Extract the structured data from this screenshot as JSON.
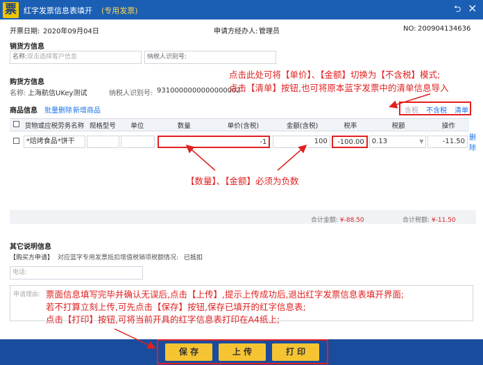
{
  "window": {
    "title": "红字发票信息表填开",
    "title_tag": "(专用发票)",
    "logo_char": "票",
    "back_icon": "undo-icon",
    "close_icon": "close-icon"
  },
  "header": {
    "date_label": "开票日期:",
    "date_value": "2020年09月04日",
    "handler_label": "申请方经办人:",
    "handler_value": "管理员",
    "no_label": "NO:",
    "no_value": "200904134636"
  },
  "seller": {
    "section": "销货方信息",
    "name_label": "名称:",
    "name_placeholder": "双击选择客户信息",
    "taxid_label": "纳税人识别号:"
  },
  "buyer": {
    "section": "购货方信息",
    "name_label": "名称:",
    "name_value": "上海航信UKey测试",
    "taxid_label": "纳税人识别号:",
    "taxid_value": "9310000000000000002"
  },
  "goods": {
    "section": "商品信息",
    "batch_delete": "批量删除",
    "add_goods": "新增商品",
    "mode_tax_included": "含税",
    "mode_tax_excluded": "不含税",
    "list_label": "清单",
    "columns": [
      "货物或应税劳务名称",
      "规格型号",
      "单位",
      "数量",
      "单价(含税)",
      "金额(含税)",
      "税率",
      "税额",
      "操作"
    ],
    "row": {
      "name": "*焙烤食品*饼干",
      "spec": "",
      "unit": "",
      "qty": "-1",
      "price": "100",
      "amount": "-100.00",
      "rate": "0.13",
      "tax": "-11.50",
      "action": "删除"
    }
  },
  "totals": {
    "amount_label": "合计金额:",
    "amount_value": "¥-88.50",
    "tax_label": "合计税额:",
    "tax_value": "¥-11.50"
  },
  "other": {
    "section": "其它说明信息",
    "buyer_apply_tag": "【购买方申请】",
    "deduct_text": "对应蓝字专用发票抵扣增值税销项税额情况:",
    "deduct_value": "已抵扣",
    "phone_label": "电话:",
    "reason_label": "申请理由:"
  },
  "annotations": {
    "mode_note_1": "点击此处可将【单价】、【金额】切换为【不含税】模式;",
    "mode_note_2": "点击【清单】按钮,也可将原本蓝字发票中的清单信息导入",
    "negative_note": "【数量】、【金额】必须为负数",
    "upload_note_1": "票面信息填写完毕并确认无误后,点击【上传】,提示上传成功后,退出红字发票信息表填开界面;",
    "upload_note_2": "若不打算立刻上传,可先点击【保存】按钮,保存已填开的红字信息表;",
    "upload_note_3": "点击【打印】按钮,可将当前开具的红字信息表打印在A4纸上;"
  },
  "buttons": {
    "save": "保 存",
    "upload": "上 传",
    "print": "打 印"
  },
  "colors": {
    "title_bar": "#1a5fb4",
    "bottom_bar": "#1a4c9e",
    "button": "#f6c433",
    "annotation": "#e02020",
    "link": "#1a73e8"
  }
}
